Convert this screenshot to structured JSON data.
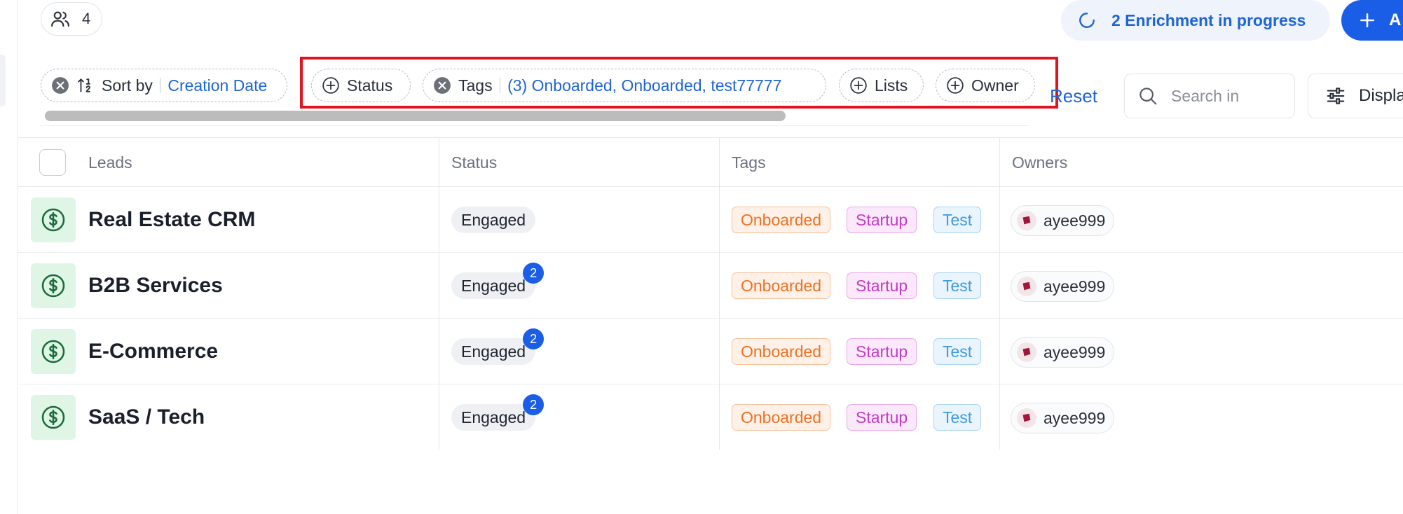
{
  "topbar": {
    "users_count": "4",
    "enrichment_label": "2 Enrichment in progress",
    "add_label": "A"
  },
  "filters": {
    "sort": {
      "label": "Sort by",
      "value": "Creation Date"
    },
    "status": {
      "label": "Status"
    },
    "tags": {
      "label": "Tags",
      "value": "(3) Onboarded, Onboarded, test77777"
    },
    "lists": {
      "label": "Lists"
    },
    "owner": {
      "label": "Owner"
    },
    "reset_label": "Reset",
    "search_placeholder": "Search in",
    "display_label": "Displa"
  },
  "table": {
    "columns": [
      "Leads",
      "Status",
      "Tags",
      "Owners"
    ],
    "rows": [
      {
        "name": "Real Estate CRM",
        "status": "Engaged",
        "count": "",
        "tags": [
          "Onboarded",
          "Startup",
          "Test"
        ],
        "owner": "ayee999"
      },
      {
        "name": "B2B Services",
        "status": "Engaged",
        "count": "2",
        "tags": [
          "Onboarded",
          "Startup",
          "Test"
        ],
        "owner": "ayee999"
      },
      {
        "name": "E-Commerce",
        "status": "Engaged",
        "count": "2",
        "tags": [
          "Onboarded",
          "Startup",
          "Test"
        ],
        "owner": "ayee999"
      },
      {
        "name": "SaaS / Tech",
        "status": "Engaged",
        "count": "2",
        "tags": [
          "Onboarded",
          "Startup",
          "Test"
        ],
        "owner": "ayee999"
      }
    ]
  },
  "colors": {
    "accent": "#1a5ee8",
    "link": "#1f64d4",
    "highlight": "#e0141e",
    "tag_onboarded": "#f07022",
    "tag_startup": "#c23bc4",
    "tag_test": "#3e9be0"
  },
  "icons": {
    "users": "users-icon",
    "enrichment": "spinner-icon",
    "add": "plus-icon",
    "remove": "close-circle-icon",
    "sort": "sort-numeric-icon",
    "add_filter": "plus-circle-icon",
    "search": "search-icon",
    "display": "sliders-icon",
    "lead": "dollar-circle-icon",
    "owner_avatar": "avatar-icon"
  }
}
